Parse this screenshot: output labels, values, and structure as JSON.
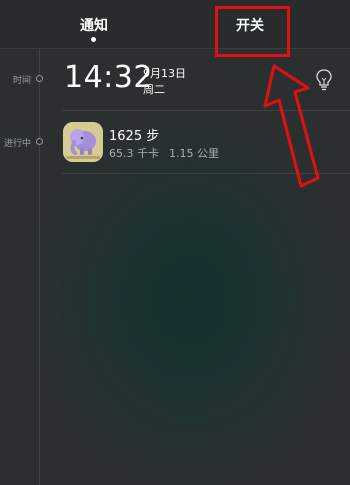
{
  "tabs": [
    {
      "label": "通知",
      "active": true
    },
    {
      "label": "开关",
      "active": false
    }
  ],
  "timeline": {
    "time_label": "时间",
    "running_label": "进行中"
  },
  "time_card": {
    "time": "14:32",
    "date": "9月13日",
    "weekday": "周二",
    "icon": "lightbulb-icon"
  },
  "activity": {
    "icon": "app-elephant-icon",
    "steps": "1625 步",
    "calories": "65.3 千卡",
    "distance": "1.15 公里"
  },
  "colors": {
    "annotation_red": "#e30f12",
    "app_icon_bg": "#d6cc93",
    "app_icon_fg": "#a58fd8"
  }
}
